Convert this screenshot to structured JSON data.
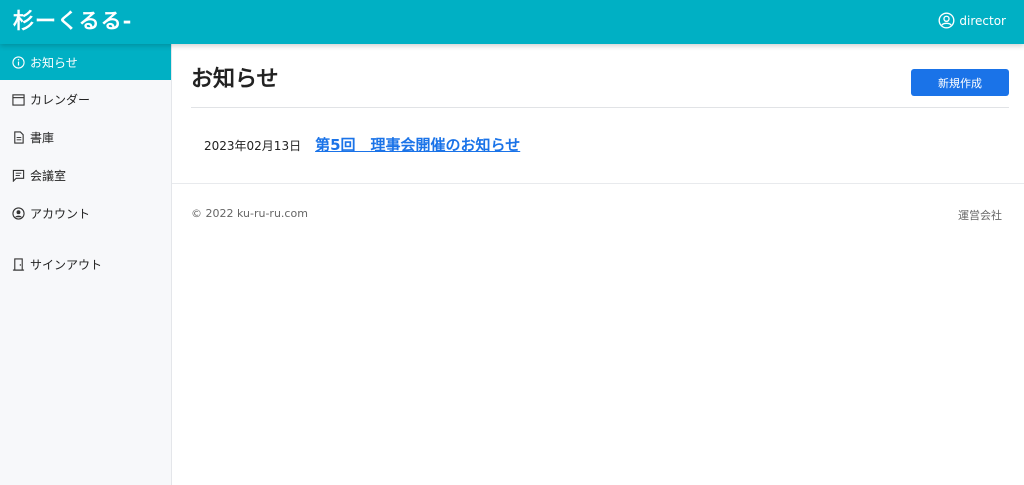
{
  "header": {
    "logo": "杉ーくるる-",
    "user": {
      "icon": "user-circle-icon",
      "name": "director"
    }
  },
  "sidebar": {
    "items": [
      {
        "label": "お知らせ",
        "icon": "info-icon",
        "active": true
      },
      {
        "label": "カレンダー",
        "icon": "calendar-icon",
        "active": false
      },
      {
        "label": "書庫",
        "icon": "document-icon",
        "active": false
      },
      {
        "label": "会議室",
        "icon": "chat-icon",
        "active": false
      },
      {
        "label": "アカウント",
        "icon": "account-icon",
        "active": false
      },
      {
        "label": "サインアウト",
        "icon": "door-icon",
        "active": false
      }
    ]
  },
  "main": {
    "title": "お知らせ",
    "new_button": "新規作成",
    "notices": [
      {
        "date": "2023年02月13日",
        "title": "第5回　理事会開催のお知らせ"
      }
    ]
  },
  "footer": {
    "copyright": "© 2022 ku-ru-ru.com",
    "company": "運営会社"
  },
  "colors": {
    "header_bg": "#00b0c4",
    "active_nav_bg": "#00b0c4",
    "primary_button": "#1a73e8",
    "link": "#1a73e8"
  }
}
